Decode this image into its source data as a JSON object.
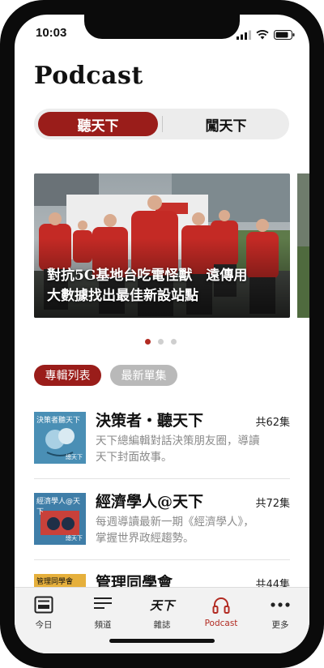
{
  "status": {
    "time": "10:03"
  },
  "page": {
    "title": "Podcast"
  },
  "segment": {
    "active": "聽天下",
    "inactive": "闖天下"
  },
  "carousel": {
    "caption_line1": "對抗5G基地台吃電怪獸　遠傳用",
    "caption_line2": "大數據找出最佳新設站點",
    "page_count": 3,
    "current_page": 1
  },
  "filters": {
    "active": "專輯列表",
    "inactive": "最新單集"
  },
  "shows": [
    {
      "title": "決策者・聽天下",
      "count": "共62集",
      "desc_line1": "天下總編輯對話決策朋友圈，導讀",
      "desc_line2": "天下封面故事。",
      "thumb_text": "決策者聽天下",
      "thumb_sub": "總天下"
    },
    {
      "title": "經濟學人@天下",
      "count": "共72集",
      "desc_line1": "每週導讀最新一期《經濟學人》，",
      "desc_line2": "掌握世界政經趨勢。",
      "thumb_text": "經濟學人@天下",
      "thumb_sub": "總天下"
    },
    {
      "title": "管理同學會",
      "count": "共44集",
      "desc_line1": "",
      "desc_line2": "",
      "thumb_text": "管理同學會",
      "thumb_sub": ""
    }
  ],
  "tabs": [
    {
      "label": "今日",
      "icon": "newspaper-icon"
    },
    {
      "label": "頻道",
      "icon": "list-icon"
    },
    {
      "label": "雜誌",
      "icon": "magazine-logo-icon",
      "logo_text": "天下"
    },
    {
      "label": "Podcast",
      "icon": "headphones-icon"
    },
    {
      "label": "更多",
      "icon": "more-icon"
    }
  ],
  "colors": {
    "accent": "#9a1d1a",
    "inactive_pill": "#b9b9b9",
    "muted_text": "#8a8a8a"
  }
}
